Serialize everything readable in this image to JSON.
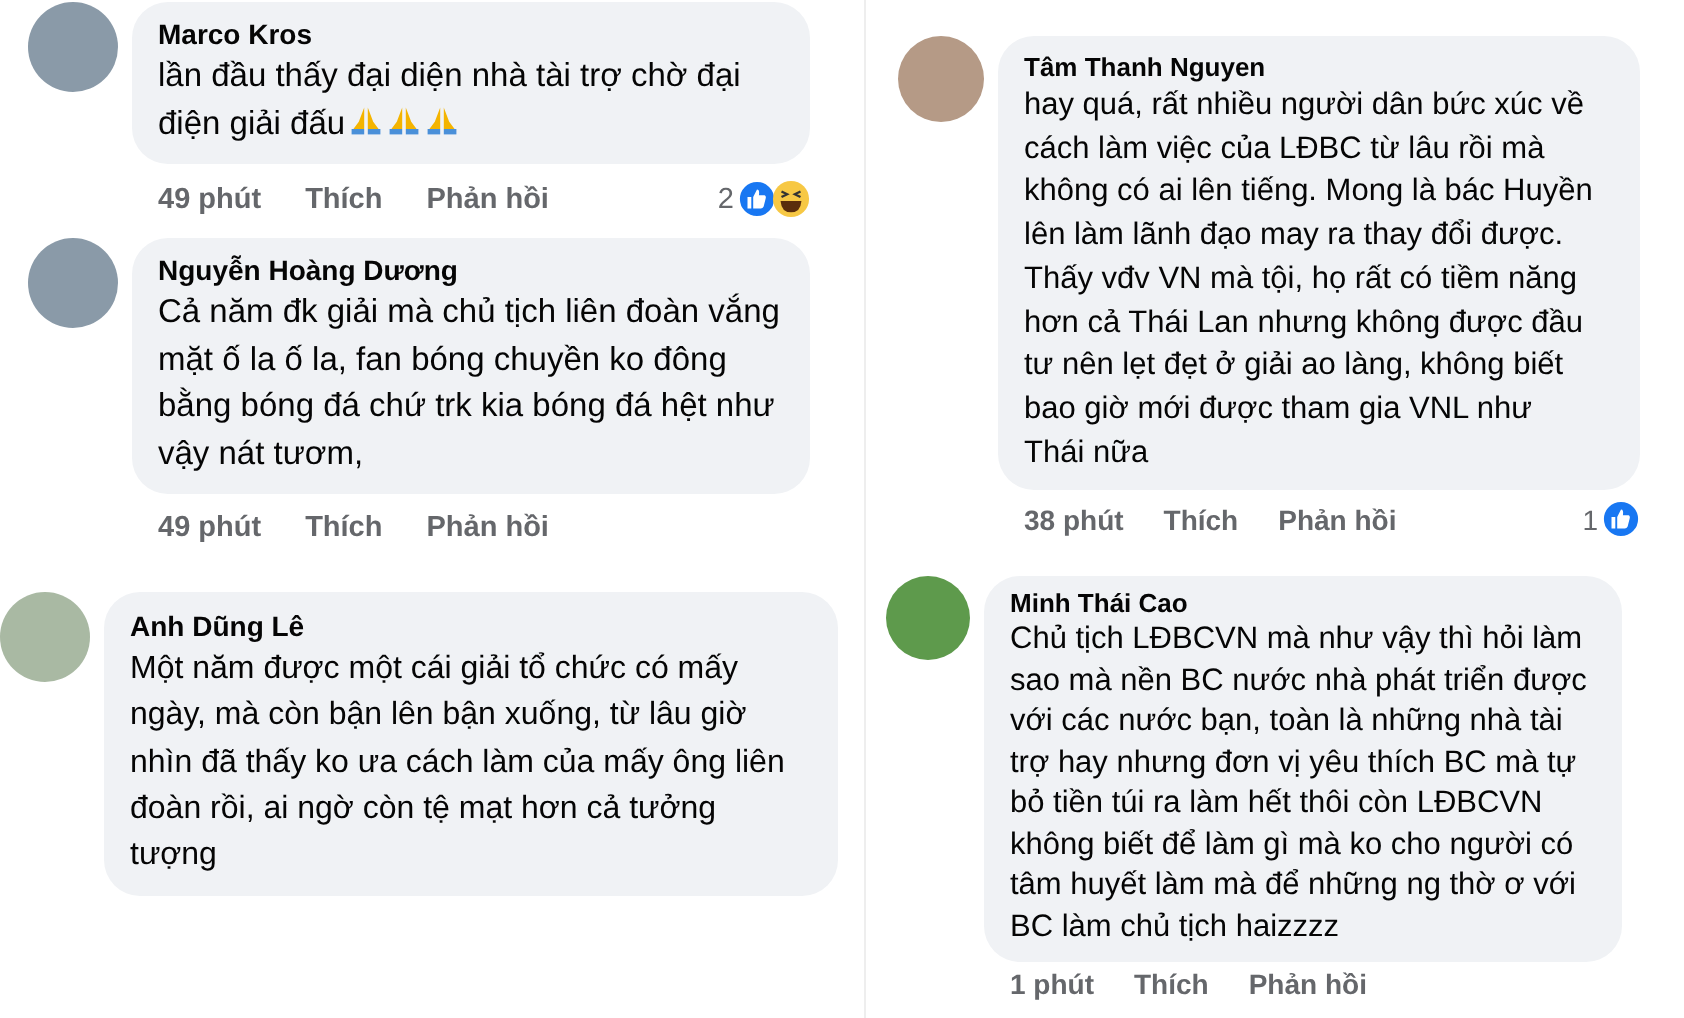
{
  "panels": [
    {
      "comments": [
        {
          "author": "Marco Kros",
          "text": "lần đầu thấy đại diện nhà tài trợ chờ đại điện giải đấu",
          "emojis": [
            {
              "kind": "pray"
            },
            {
              "kind": "pray"
            },
            {
              "kind": "pray"
            }
          ],
          "time": "49 phút",
          "like": "Thích",
          "reply": "Phản hồi",
          "reaction_count": "2",
          "reactions": [
            {
              "kind": "like"
            },
            {
              "kind": "haha"
            }
          ]
        },
        {
          "author": "Nguyễn Hoàng Dương",
          "text": "Cả năm đk giải mà chủ tịch liên đoàn vắng mặt ố la ố la, fan bóng chuyền ko đông bằng bóng đá chứ trk kia bóng đá hệt như vậy nát tươm,",
          "time": "49 phút",
          "like": "Thích",
          "reply": "Phản hồi"
        }
      ]
    },
    {
      "comments": [
        {
          "author": "Tâm Thanh Nguyen",
          "text": "hay quá, rất nhiều người dân bức xúc về cách làm việc của LĐBC từ lâu rồi mà không có ai lên tiếng. Mong là bác Huyền lên làm lãnh đạo may ra thay đổi được.   Thấy vđv VN mà tội, họ rất có tiềm năng hơn cả Thái Lan nhưng không được đầu tư nên lẹt đẹt ở giải ao làng, không biết bao giờ mới được tham gia VNL như Thái nữa",
          "time": "38 phút",
          "like": "Thích",
          "reply": "Phản hồi",
          "reaction_count": "1",
          "reactions": [
            {
              "kind": "like"
            }
          ]
        }
      ]
    },
    {
      "comments": [
        {
          "author": "Anh Dũng Lê",
          "text": "Một năm được một cái giải tổ chức có mấy ngày, mà còn bận lên bận xuống, từ lâu giờ nhìn đã thấy ko ưa cách làm của mấy ông liên đoàn rồi, ai ngờ còn tệ mạt hơn cả tưởng tượng"
        }
      ]
    },
    {
      "comments": [
        {
          "author": "Minh Thái Cao",
          "text": "Chủ tịch LĐBCVN mà như vậy thì hỏi làm sao mà nền BC nước nhà phát triển được với các nước bạn, toàn là những nhà tài trợ hay nhưng đơn vị yêu thích BC mà tự bỏ tiền túi ra làm hết thôi còn LĐBCVN không biết để làm gì mà ko cho người có tâm huyết làm mà để những ng thờ ơ với BC làm chủ tịch haizzzz",
          "time": "1 phút",
          "like": "Thích",
          "reply": "Phản hồi"
        }
      ]
    }
  ]
}
